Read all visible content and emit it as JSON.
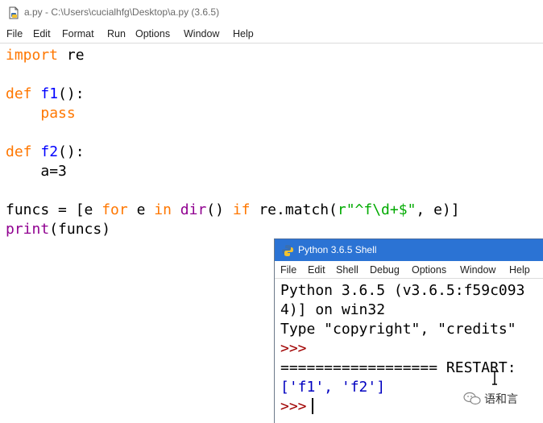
{
  "editor": {
    "title": "a.py - C:\\Users\\cucialhfg\\Desktop\\a.py (3.6.5)",
    "menu": [
      "File",
      "Edit",
      "Format",
      "Run",
      "Options",
      "Window",
      "Help"
    ],
    "code": {
      "l1_kw": "import",
      "l1_rest": " re",
      "l3_kw": "def",
      "l3_sp": " ",
      "l3_fn": "f1",
      "l3_rest": "():",
      "l4_kw": "pass",
      "l6_kw": "def",
      "l6_sp": " ",
      "l6_fn": "f2",
      "l6_rest": "():",
      "l7": "a=3",
      "l9_a": "funcs = [e ",
      "l9_for": "for",
      "l9_b": " e ",
      "l9_in": "in",
      "l9_c": " ",
      "l9_dir": "dir",
      "l9_d": "() ",
      "l9_if": "if",
      "l9_e": " re.match(",
      "l9_str": "r\"^f\\d+$\"",
      "l9_f": ", e)]",
      "l10_print": "print",
      "l10_rest": "(funcs)"
    }
  },
  "shell": {
    "title": "Python 3.6.5 Shell",
    "menu": [
      "File",
      "Edit",
      "Shell",
      "Debug",
      "Options",
      "Window",
      "Help"
    ],
    "lines": {
      "l1": "Python 3.6.5 (v3.6.5:f59c093",
      "l2": "4)] on win32",
      "l3": "Type \"copyright\", \"credits\"",
      "l4": ">>>",
      "l5": "================== RESTART:",
      "l6": "['f1', 'f2']",
      "l7": ">>>"
    }
  },
  "watermark": {
    "text": "语和言"
  }
}
